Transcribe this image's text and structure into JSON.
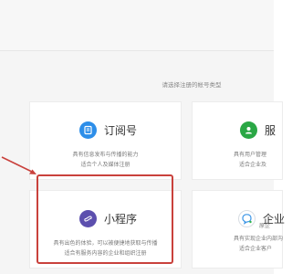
{
  "prompt": "请选择注册的帐号类型",
  "cards": {
    "subscription": {
      "title": "订阅号",
      "desc1": "具有信息发布与传播的能力",
      "desc2": "适合个人及媒体注册"
    },
    "service": {
      "title": "服",
      "desc1": "具有用户管理",
      "desc2": "适合企业及"
    },
    "miniprogram": {
      "title": "小程序",
      "desc1": "具有出色的体验，可以被便捷地获取与传播",
      "desc2": "适合有服务内容的企业和组织注册"
    },
    "enterprise": {
      "title": "企业",
      "subtitle": "原企",
      "desc1": "具有实现企业内部沟",
      "desc2": "适合企业客户"
    }
  },
  "colors": {
    "accent_blue": "#2d8ee9",
    "accent_green": "#2aa745",
    "accent_purple": "#5c4fae",
    "highlight_red": "#c9413c"
  },
  "icons": {
    "subscription": "document-icon",
    "service": "user-icon",
    "miniprogram": "miniprogram-icon",
    "enterprise": "chat-bubble-icon",
    "annotation": "red-arrow-icon"
  }
}
